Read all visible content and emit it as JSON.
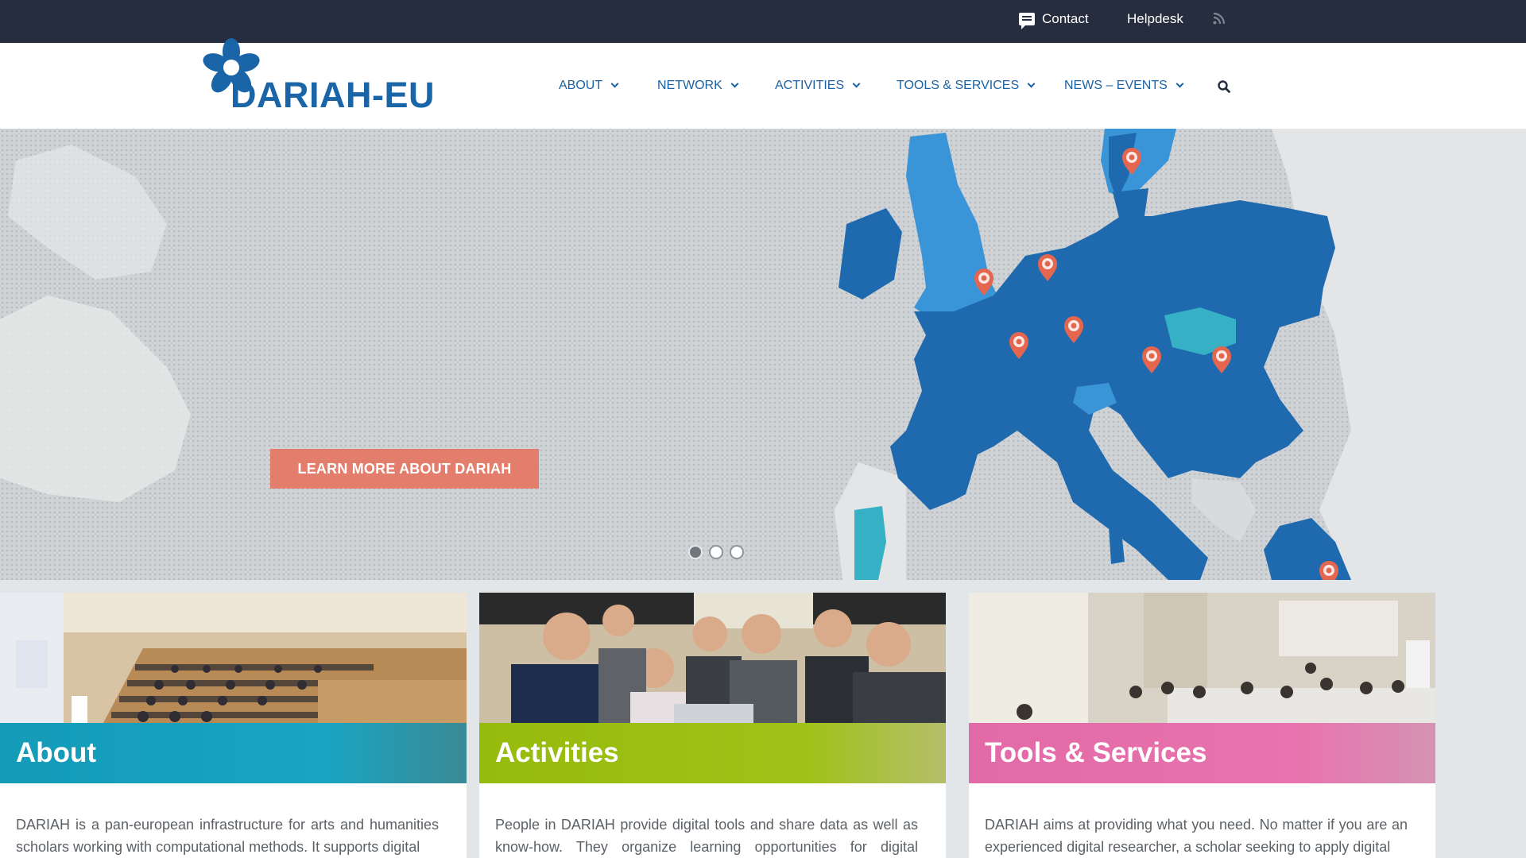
{
  "topbar": {
    "contact_label": "Contact",
    "helpdesk_label": "Helpdesk",
    "contact_icon": "chat-icon",
    "rss_icon": "rss-icon"
  },
  "header": {
    "logo_text": "DARIAH-EU",
    "nav": [
      {
        "label": "ABOUT"
      },
      {
        "label": "NETWORK"
      },
      {
        "label": "ACTIVITIES"
      },
      {
        "label": "TOOLS & SERVICES"
      },
      {
        "label": "NEWS – EVENTS"
      }
    ],
    "search_icon": "search-icon"
  },
  "hero": {
    "cta_label": "LEARN MORE ABOUT DARIAH",
    "slides_total": 3,
    "active_slide": 1
  },
  "cards": [
    {
      "title": "About",
      "text": "DARIAH is a pan-european infrastructure for arts and humanities scholars working with computational methods. It supports digital"
    },
    {
      "title": "Activities",
      "text": "People in DARIAH provide digital tools and share data as well as know-how. They organize learning opportunities for digital research"
    },
    {
      "title": "Tools & Services",
      "text": "DARIAH aims at providing what you need. No matter if you are an experienced digital researcher, a scholar seeking to apply digital"
    }
  ],
  "colors": {
    "topbar": "#262d3e",
    "nav_text": "#1b62a3",
    "cta": "#e47e6c",
    "about": "#139bb8",
    "activities": "#95bb0c",
    "tools": "#e26aa7",
    "map_member": "#1f6aaf",
    "map_cooperating": "#3a95d8",
    "map_observer": "#35b0c4"
  }
}
